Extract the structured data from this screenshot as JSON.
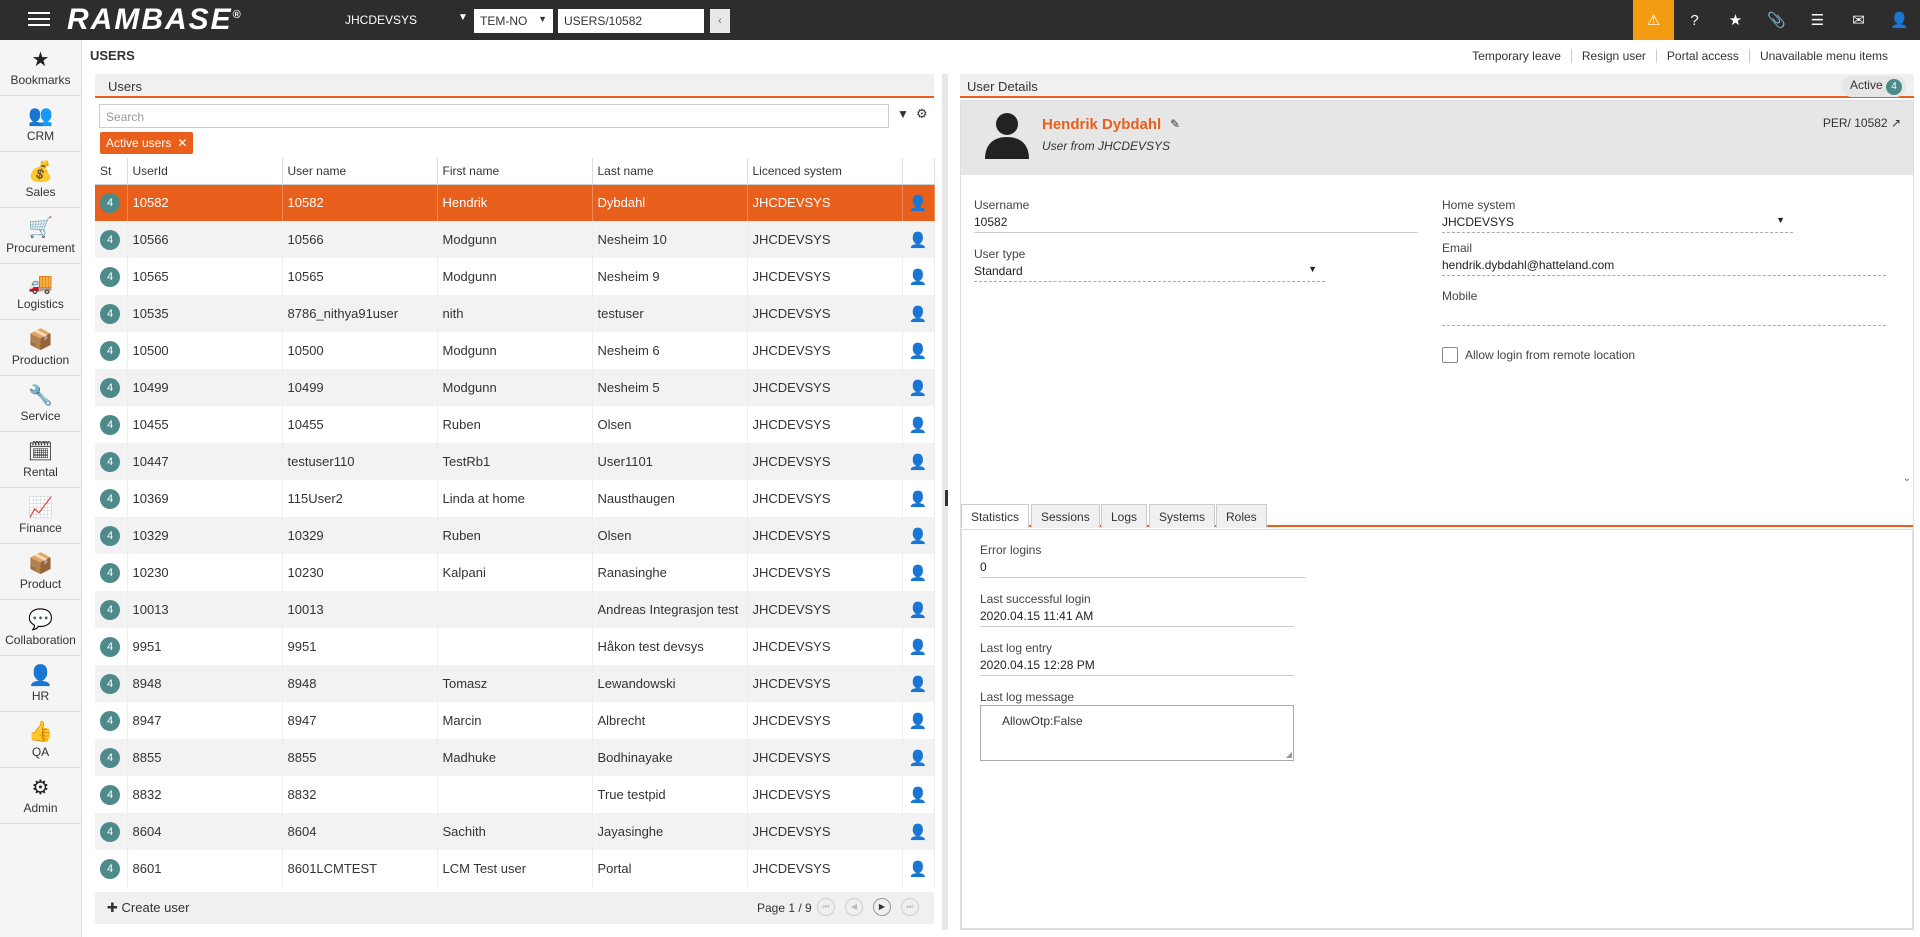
{
  "topbar": {
    "logo": "RAMBASE",
    "logo_mark": "®",
    "system": "JHCDEVSYS",
    "company": "TEM-NO",
    "path": "USERS/10582",
    "icons": [
      "warning-icon",
      "help-icon",
      "star-icon",
      "paperclip-icon",
      "list-icon",
      "mail-icon",
      "user-icon"
    ]
  },
  "nav": [
    {
      "label": "Bookmarks",
      "icon": "★"
    },
    {
      "label": "CRM",
      "icon": "👥"
    },
    {
      "label": "Sales",
      "icon": "💰"
    },
    {
      "label": "Procurement",
      "icon": "🛒"
    },
    {
      "label": "Logistics",
      "icon": "🚚"
    },
    {
      "label": "Production",
      "icon": "📦"
    },
    {
      "label": "Service",
      "icon": "🔧"
    },
    {
      "label": "Rental",
      "icon": "🗓"
    },
    {
      "label": "Finance",
      "icon": "📈"
    },
    {
      "label": "Product",
      "icon": "📦"
    },
    {
      "label": "Collaboration",
      "icon": "💬"
    },
    {
      "label": "HR",
      "icon": "👤"
    },
    {
      "label": "QA",
      "icon": "👍"
    },
    {
      "label": "Admin",
      "icon": "⚙"
    }
  ],
  "page": {
    "title": "USERS",
    "actions": [
      "Temporary leave",
      "Resign user",
      "Portal access",
      "Unavailable menu items"
    ]
  },
  "users": {
    "panel_title": "Users",
    "search_placeholder": "Search",
    "chip": "Active users",
    "columns": [
      "St",
      "UserId",
      "User name",
      "First name",
      "Last name",
      "Licenced system"
    ],
    "rows": [
      {
        "st": "4",
        "id": "10582",
        "username": "10582",
        "first": "Hendrik",
        "last": "Dybdahl",
        "system": "JHCDEVSYS",
        "selected": true
      },
      {
        "st": "4",
        "id": "10566",
        "username": "10566",
        "first": "Modgunn",
        "last": "Nesheim 10",
        "system": "JHCDEVSYS"
      },
      {
        "st": "4",
        "id": "10565",
        "username": "10565",
        "first": "Modgunn",
        "last": "Nesheim 9",
        "system": "JHCDEVSYS"
      },
      {
        "st": "4",
        "id": "10535",
        "username": "8786_nithya91user",
        "first": "nith",
        "last": "testuser",
        "system": "JHCDEVSYS"
      },
      {
        "st": "4",
        "id": "10500",
        "username": "10500",
        "first": "Modgunn",
        "last": "Nesheim 6",
        "system": "JHCDEVSYS"
      },
      {
        "st": "4",
        "id": "10499",
        "username": "10499",
        "first": "Modgunn",
        "last": "Nesheim 5",
        "system": "JHCDEVSYS"
      },
      {
        "st": "4",
        "id": "10455",
        "username": "10455",
        "first": "Ruben",
        "last": "Olsen",
        "system": "JHCDEVSYS"
      },
      {
        "st": "4",
        "id": "10447",
        "username": "testuser110",
        "first": "TestRb1",
        "last": "User1101",
        "system": "JHCDEVSYS"
      },
      {
        "st": "4",
        "id": "10369",
        "username": "115User2",
        "first": "Linda at home",
        "last": "Nausthaugen",
        "system": "JHCDEVSYS"
      },
      {
        "st": "4",
        "id": "10329",
        "username": "10329",
        "first": "Ruben",
        "last": "Olsen",
        "system": "JHCDEVSYS"
      },
      {
        "st": "4",
        "id": "10230",
        "username": "10230",
        "first": "Kalpani",
        "last": "Ranasinghe",
        "system": "JHCDEVSYS"
      },
      {
        "st": "4",
        "id": "10013",
        "username": "10013",
        "first": "",
        "last": "Andreas Integrasjon test",
        "system": "JHCDEVSYS"
      },
      {
        "st": "4",
        "id": "9951",
        "username": "9951",
        "first": "",
        "last": "Håkon test devsys",
        "system": "JHCDEVSYS"
      },
      {
        "st": "4",
        "id": "8948",
        "username": "8948",
        "first": "Tomasz",
        "last": "Lewandowski",
        "system": "JHCDEVSYS"
      },
      {
        "st": "4",
        "id": "8947",
        "username": "8947",
        "first": "Marcin",
        "last": "Albrecht",
        "system": "JHCDEVSYS"
      },
      {
        "st": "4",
        "id": "8855",
        "username": "8855",
        "first": "Madhuke",
        "last": "Bodhinayake",
        "system": "JHCDEVSYS"
      },
      {
        "st": "4",
        "id": "8832",
        "username": "8832",
        "first": "",
        "last": "True testpid",
        "system": "JHCDEVSYS"
      },
      {
        "st": "4",
        "id": "8604",
        "username": "8604",
        "first": "Sachith",
        "last": "Jayasinghe",
        "system": "JHCDEVSYS"
      },
      {
        "st": "4",
        "id": "8601",
        "username": "8601LCMTEST",
        "first": "LCM Test user",
        "last": "Portal",
        "system": "JHCDEVSYS"
      }
    ],
    "create_label": "Create user",
    "pager": "Page 1 / 9"
  },
  "details": {
    "title": "User Details",
    "status": "Active",
    "status_count": "4",
    "name": "Hendrik Dybdahl",
    "subtitle": "User from JHCDEVSYS",
    "per": "PER/ 10582",
    "username_label": "Username",
    "username": "10582",
    "usertype_label": "User type",
    "usertype": "Standard",
    "home_label": "Home system",
    "home": "JHCDEVSYS",
    "email_label": "Email",
    "email": "hendrik.dybdahl@hatteland.com",
    "mobile_label": "Mobile",
    "mobile": "",
    "remote_label": "Allow login from remote location",
    "tabs": [
      "Statistics",
      "Sessions",
      "Logs",
      "Systems",
      "Roles"
    ],
    "stats": {
      "error_label": "Error logins",
      "error": "0",
      "last_login_label": "Last successful login",
      "last_login": "2020.04.15 11:41 AM",
      "last_log_label": "Last log entry",
      "last_log": "2020.04.15 12:28 PM",
      "msg_label": "Last log message",
      "msg": "AllowOtp:False"
    }
  }
}
